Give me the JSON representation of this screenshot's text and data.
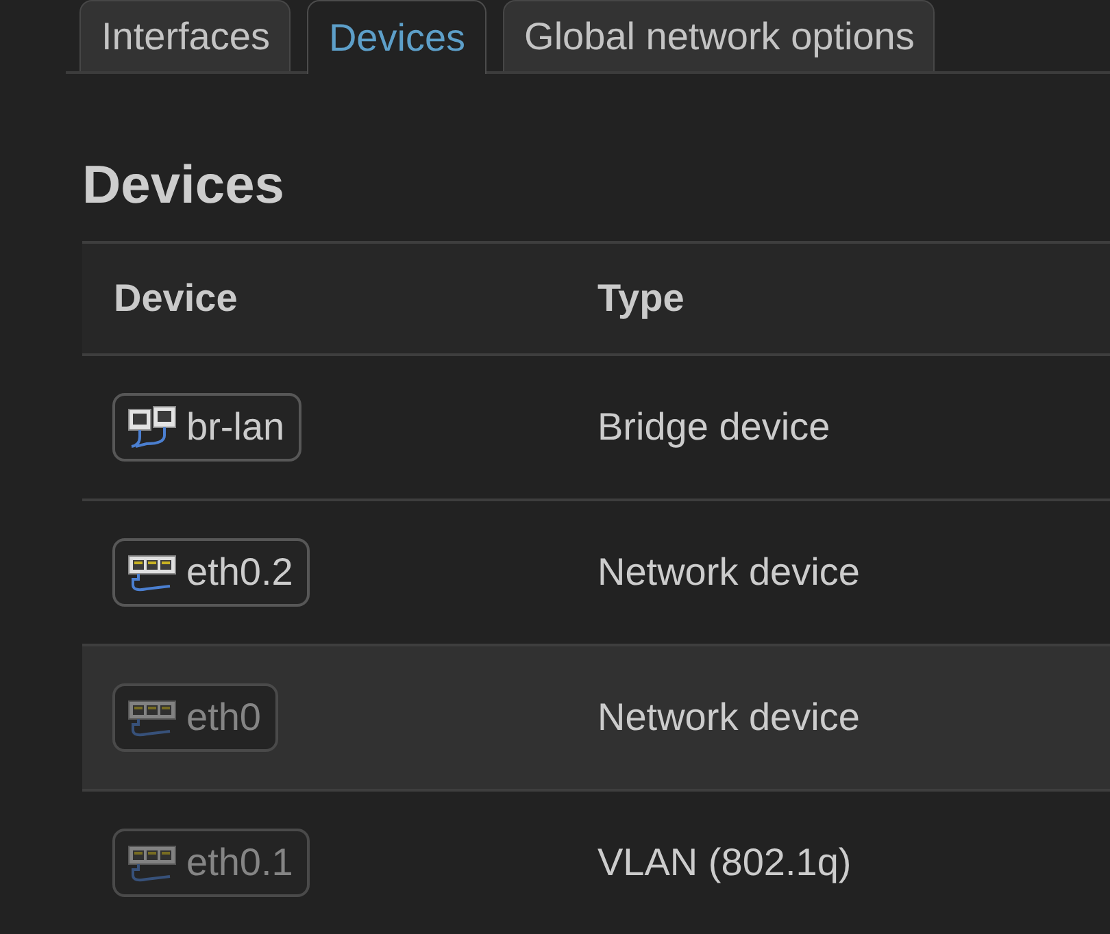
{
  "tabs": [
    {
      "label": "Interfaces",
      "selected": false
    },
    {
      "label": "Devices",
      "selected": true
    },
    {
      "label": "Global network options",
      "selected": false
    }
  ],
  "section": {
    "title": "Devices"
  },
  "table": {
    "columns": [
      "Device",
      "Type"
    ],
    "rows": [
      {
        "device": "br-lan",
        "kind": "bridge",
        "up": true,
        "type": "Bridge device",
        "highlighted": false
      },
      {
        "device": "eth0.2",
        "kind": "switch",
        "up": true,
        "type": "Network device",
        "highlighted": false
      },
      {
        "device": "eth0",
        "kind": "switch",
        "up": false,
        "type": "Network device",
        "highlighted": true
      },
      {
        "device": "eth0.1",
        "kind": "switch",
        "up": false,
        "type": "VLAN (802.1q)",
        "highlighted": false
      }
    ]
  }
}
